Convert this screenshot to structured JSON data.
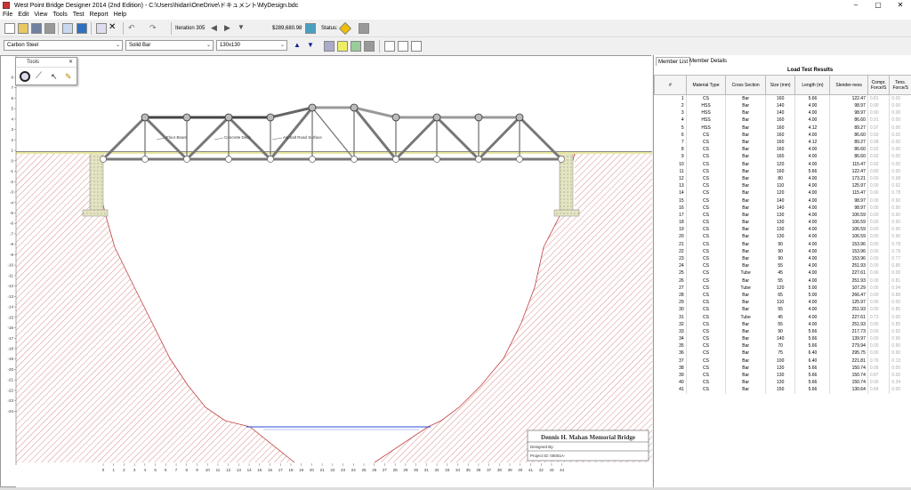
{
  "window": {
    "title": "West Point Bridge Designer 2014 (2nd Edition) - C:\\Users\\hidan\\OneDrive\\ドキュメント\\MyDesign.bdc",
    "minimize": "–",
    "maximize": "▢",
    "close": "✕"
  },
  "menu": [
    "File",
    "Edit",
    "View",
    "Tools",
    "Test",
    "Report",
    "Help"
  ],
  "toolbar": {
    "iteration": "Iteration 305",
    "cost": "$289,680.98",
    "status_label": "Status:"
  },
  "selectors": {
    "material": "Carbon Steel",
    "section": "Solid Bar",
    "size": "130x130"
  },
  "tools_palette": {
    "title": "Tools"
  },
  "tabs": [
    "Member List",
    "Member Details"
  ],
  "table": {
    "title": "Load Test Results",
    "headers": [
      "#",
      "Material Type",
      "Cross Section",
      "Size (mm)",
      "Length (m)",
      "Slender-ness",
      "Compr. Force/S",
      "Tens. Force/S"
    ],
    "rows": [
      [
        "1",
        "CS",
        "Bar",
        "160",
        "5.66",
        "122.47",
        "0.81",
        "0.00"
      ],
      [
        "2",
        "HSS",
        "Bar",
        "140",
        "4.00",
        "98.97",
        "0.90",
        "0.00"
      ],
      [
        "3",
        "HSS",
        "Bar",
        "140",
        "4.00",
        "98.97",
        "0.90",
        "0.00"
      ],
      [
        "4",
        "HSS",
        "Bar",
        "160",
        "4.00",
        "86.60",
        "0.91",
        "0.00"
      ],
      [
        "5",
        "HSS",
        "Bar",
        "160",
        "4.12",
        "89.27",
        "0.97",
        "0.00"
      ],
      [
        "6",
        "CS",
        "Bar",
        "160",
        "4.00",
        "86.60",
        "0.93",
        "0.00"
      ],
      [
        "7",
        "CS",
        "Bar",
        "160",
        "4.12",
        "89.27",
        "0.98",
        "0.00"
      ],
      [
        "8",
        "CS",
        "Bar",
        "160",
        "4.00",
        "86.60",
        "0.92",
        "0.00"
      ],
      [
        "9",
        "CS",
        "Bar",
        "160",
        "4.00",
        "86.60",
        "0.92",
        "0.00"
      ],
      [
        "10",
        "CS",
        "Bar",
        "120",
        "4.00",
        "115.47",
        "0.92",
        "0.00"
      ],
      [
        "11",
        "CS",
        "Bar",
        "160",
        "5.66",
        "122.47",
        "0.80",
        "0.00"
      ],
      [
        "12",
        "CS",
        "Bar",
        "80",
        "4.00",
        "173.21",
        "0.00",
        "0.98"
      ],
      [
        "13",
        "CS",
        "Bar",
        "110",
        "4.00",
        "125.97",
        "0.00",
        "0.92"
      ],
      [
        "14",
        "CS",
        "Bar",
        "120",
        "4.00",
        "115.47",
        "0.00",
        "0.78"
      ],
      [
        "15",
        "CS",
        "Bar",
        "140",
        "4.00",
        "98.97",
        "0.00",
        "0.90"
      ],
      [
        "16",
        "CS",
        "Bar",
        "140",
        "4.00",
        "98.97",
        "0.00",
        "0.90"
      ],
      [
        "17",
        "CS",
        "Bar",
        "130",
        "4.00",
        "106.59",
        "0.00",
        "0.90"
      ],
      [
        "18",
        "CS",
        "Bar",
        "130",
        "4.00",
        "106.59",
        "0.00",
        "0.90"
      ],
      [
        "19",
        "CS",
        "Bar",
        "130",
        "4.00",
        "106.59",
        "0.00",
        "0.90"
      ],
      [
        "20",
        "CS",
        "Bar",
        "130",
        "4.00",
        "106.59",
        "0.00",
        "0.90"
      ],
      [
        "21",
        "CS",
        "Bar",
        "90",
        "4.00",
        "153.96",
        "0.00",
        "0.78"
      ],
      [
        "22",
        "CS",
        "Bar",
        "90",
        "4.00",
        "153.96",
        "0.00",
        "0.78"
      ],
      [
        "23",
        "CS",
        "Bar",
        "90",
        "4.00",
        "153.96",
        "0.00",
        "0.77"
      ],
      [
        "24",
        "CS",
        "Bar",
        "55",
        "4.00",
        "251.93",
        "0.00",
        "0.85"
      ],
      [
        "25",
        "CS",
        "Tube",
        "45",
        "4.00",
        "227.61",
        "0.96",
        "0.00"
      ],
      [
        "26",
        "CS",
        "Bar",
        "55",
        "4.00",
        "251.93",
        "0.00",
        "0.81"
      ],
      [
        "27",
        "CS",
        "Tube",
        "120",
        "5.00",
        "107.29",
        "0.00",
        "0.94"
      ],
      [
        "28",
        "CS",
        "Bar",
        "65",
        "5.00",
        "266.47",
        "0.00",
        "0.88"
      ],
      [
        "29",
        "CS",
        "Bar",
        "110",
        "4.00",
        "125.97",
        "0.90",
        "0.00"
      ],
      [
        "30",
        "CS",
        "Bar",
        "55",
        "4.00",
        "251.93",
        "0.00",
        "0.85"
      ],
      [
        "31",
        "CS",
        "Tube",
        "45",
        "4.00",
        "227.61",
        "0.73",
        "0.00"
      ],
      [
        "32",
        "CS",
        "Bar",
        "55",
        "4.00",
        "251.93",
        "0.00",
        "0.85"
      ],
      [
        "33",
        "CS",
        "Bar",
        "90",
        "5.66",
        "217.73",
        "0.00",
        "0.92"
      ],
      [
        "34",
        "CS",
        "Bar",
        "140",
        "5.66",
        "139.97",
        "0.00",
        "0.90"
      ],
      [
        "35",
        "CS",
        "Bar",
        "70",
        "5.66",
        "279.94",
        "0.00",
        "0.90"
      ],
      [
        "36",
        "CS",
        "Bar",
        "75",
        "6.40",
        "295.75",
        "0.00",
        "0.90"
      ],
      [
        "37",
        "CS",
        "Bar",
        "100",
        "6.40",
        "221.81",
        "0.76",
        "0.13"
      ],
      [
        "38",
        "CS",
        "Bar",
        "130",
        "5.66",
        "150.74",
        "0.99",
        "0.00"
      ],
      [
        "39",
        "CS",
        "Bar",
        "130",
        "5.66",
        "150.74",
        "0.87",
        "0.00"
      ],
      [
        "40",
        "CS",
        "Bar",
        "130",
        "5.66",
        "150.74",
        "0.00",
        "0.34"
      ],
      [
        "41",
        "CS",
        "Bar",
        "150",
        "5.66",
        "130.64",
        "0.84",
        "0.00"
      ]
    ]
  },
  "drawing": {
    "labels": {
      "floor_beam": "Floor Beam",
      "concrete_deck": "Concrete Deck",
      "asphalt": "Asphalt Road Surface"
    },
    "y_ticks": [
      "8",
      "7",
      "6",
      "5",
      "4",
      "3",
      "2",
      "1",
      "0",
      "-1",
      "-2",
      "-3",
      "-4",
      "-5",
      "-6",
      "-7",
      "-8",
      "-9",
      "-10",
      "-11",
      "-12",
      "-13",
      "-14",
      "-15",
      "-16",
      "-17",
      "-18",
      "-19",
      "-20",
      "-21",
      "-22",
      "-23",
      "-24"
    ],
    "x_ticks": [
      "0",
      "1",
      "2",
      "3",
      "4",
      "5",
      "6",
      "7",
      "8",
      "9",
      "10",
      "11",
      "12",
      "13",
      "14",
      "15",
      "16",
      "17",
      "18",
      "19",
      "20",
      "21",
      "22",
      "23",
      "24",
      "25",
      "26",
      "27",
      "28",
      "29",
      "30",
      "31",
      "32",
      "33",
      "34",
      "35",
      "36",
      "37",
      "38",
      "39",
      "40",
      "41",
      "42",
      "43",
      "44"
    ],
    "title_block": {
      "name": "Dennis H. Mahan Memorial Bridge",
      "designed_by": "Designed By:",
      "project_id": "Project ID: 00001A-"
    }
  },
  "colors": {
    "deck": "#e8e8a0",
    "hatch": "#c04040",
    "member": "#777777"
  }
}
